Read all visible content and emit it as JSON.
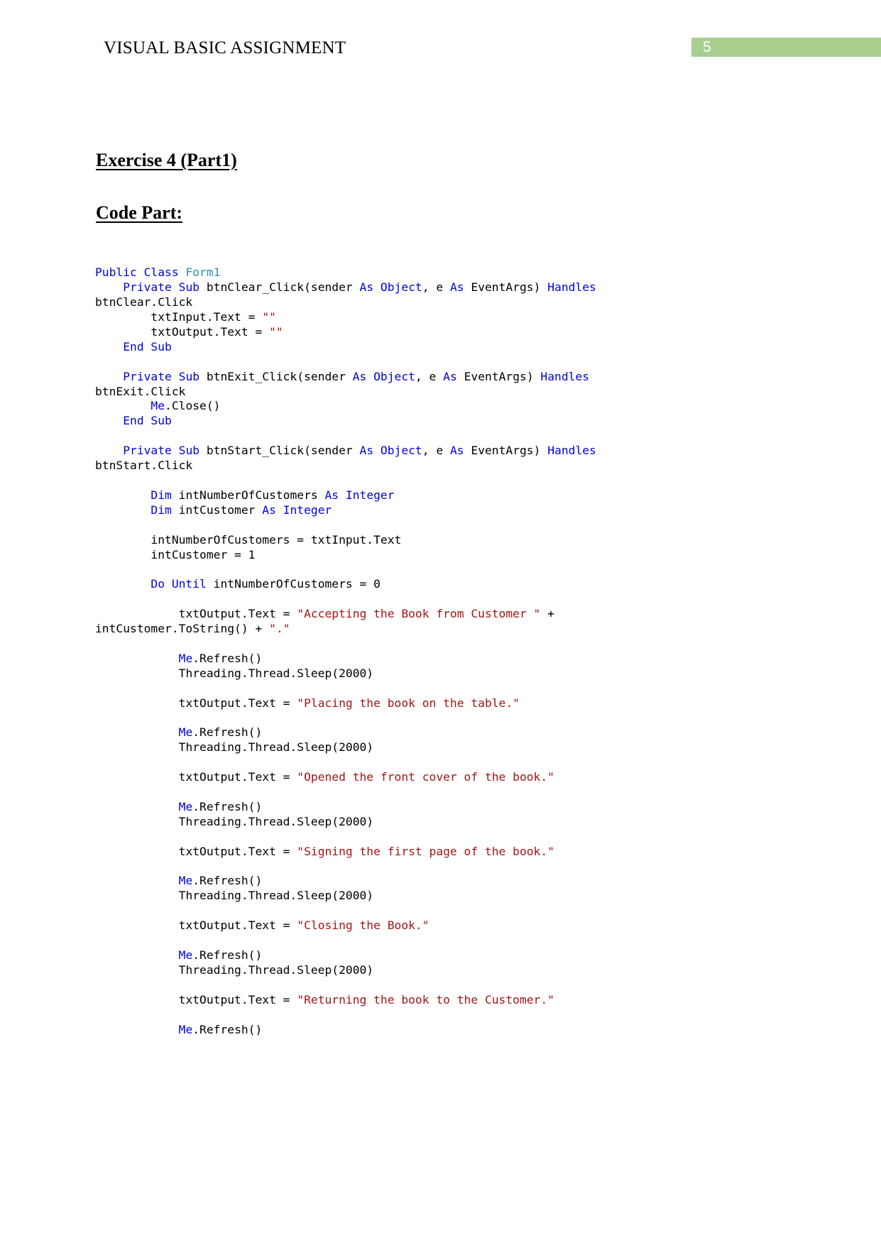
{
  "header": {
    "title": "VISUAL BASIC ASSIGNMENT",
    "page_number": "5",
    "bar_color": "#a9cf8e"
  },
  "headings": {
    "exercise": "Exercise 4 (Part1)",
    "code_part": "Code Part:"
  },
  "code": {
    "language": "Visual Basic .NET",
    "colors": {
      "keyword": "#0000e0",
      "type": "#2b91af",
      "string": "#a31515",
      "plain": "#000000"
    },
    "lines": [
      [
        {
          "t": "Public Class ",
          "c": "kw"
        },
        {
          "t": "Form1",
          "c": "typ"
        }
      ],
      [
        {
          "t": "    ",
          "c": "pl"
        },
        {
          "t": "Private Sub ",
          "c": "kw"
        },
        {
          "t": "btnClear_Click(sender ",
          "c": "pl"
        },
        {
          "t": "As Object",
          "c": "kw"
        },
        {
          "t": ", e ",
          "c": "pl"
        },
        {
          "t": "As ",
          "c": "kw"
        },
        {
          "t": "EventArgs) ",
          "c": "pl"
        },
        {
          "t": "Handles ",
          "c": "kw"
        },
        {
          "t": "btnClear.Click",
          "c": "pl"
        }
      ],
      [
        {
          "t": "        txtInput.Text = ",
          "c": "pl"
        },
        {
          "t": "\"\"",
          "c": "str"
        }
      ],
      [
        {
          "t": "        txtOutput.Text = ",
          "c": "pl"
        },
        {
          "t": "\"\"",
          "c": "str"
        }
      ],
      [
        {
          "t": "    ",
          "c": "pl"
        },
        {
          "t": "End Sub",
          "c": "kw"
        }
      ],
      [
        {
          "t": "",
          "c": "pl"
        }
      ],
      [
        {
          "t": "    ",
          "c": "pl"
        },
        {
          "t": "Private Sub ",
          "c": "kw"
        },
        {
          "t": "btnExit_Click(sender ",
          "c": "pl"
        },
        {
          "t": "As Object",
          "c": "kw"
        },
        {
          "t": ", e ",
          "c": "pl"
        },
        {
          "t": "As ",
          "c": "kw"
        },
        {
          "t": "EventArgs) ",
          "c": "pl"
        },
        {
          "t": "Handles ",
          "c": "kw"
        },
        {
          "t": "btnExit.Click",
          "c": "pl"
        }
      ],
      [
        {
          "t": "        ",
          "c": "pl"
        },
        {
          "t": "Me",
          "c": "kw"
        },
        {
          "t": ".Close()",
          "c": "pl"
        }
      ],
      [
        {
          "t": "    ",
          "c": "pl"
        },
        {
          "t": "End Sub",
          "c": "kw"
        }
      ],
      [
        {
          "t": "",
          "c": "pl"
        }
      ],
      [
        {
          "t": "    ",
          "c": "pl"
        },
        {
          "t": "Private Sub ",
          "c": "kw"
        },
        {
          "t": "btnStart_Click(sender ",
          "c": "pl"
        },
        {
          "t": "As Object",
          "c": "kw"
        },
        {
          "t": ", e ",
          "c": "pl"
        },
        {
          "t": "As ",
          "c": "kw"
        },
        {
          "t": "EventArgs) ",
          "c": "pl"
        },
        {
          "t": "Handles ",
          "c": "kw"
        },
        {
          "t": "btnStart.Click",
          "c": "pl"
        }
      ],
      [
        {
          "t": "",
          "c": "pl"
        }
      ],
      [
        {
          "t": "        ",
          "c": "pl"
        },
        {
          "t": "Dim ",
          "c": "kw"
        },
        {
          "t": "intNumberOfCustomers ",
          "c": "pl"
        },
        {
          "t": "As Integer",
          "c": "kw"
        }
      ],
      [
        {
          "t": "        ",
          "c": "pl"
        },
        {
          "t": "Dim ",
          "c": "kw"
        },
        {
          "t": "intCustomer ",
          "c": "pl"
        },
        {
          "t": "As Integer",
          "c": "kw"
        }
      ],
      [
        {
          "t": "",
          "c": "pl"
        }
      ],
      [
        {
          "t": "        intNumberOfCustomers = txtInput.Text",
          "c": "pl"
        }
      ],
      [
        {
          "t": "        intCustomer = 1",
          "c": "pl"
        }
      ],
      [
        {
          "t": "",
          "c": "pl"
        }
      ],
      [
        {
          "t": "        ",
          "c": "pl"
        },
        {
          "t": "Do Until ",
          "c": "kw"
        },
        {
          "t": "intNumberOfCustomers = 0",
          "c": "pl"
        }
      ],
      [
        {
          "t": "",
          "c": "pl"
        }
      ],
      [
        {
          "t": "            txtOutput.Text = ",
          "c": "pl"
        },
        {
          "t": "\"Accepting the Book from Customer \"",
          "c": "str"
        },
        {
          "t": " + intCustomer.ToString() + ",
          "c": "pl"
        },
        {
          "t": "\".\"",
          "c": "str"
        }
      ],
      [
        {
          "t": "",
          "c": "pl"
        }
      ],
      [
        {
          "t": "            ",
          "c": "pl"
        },
        {
          "t": "Me",
          "c": "kw"
        },
        {
          "t": ".Refresh()",
          "c": "pl"
        }
      ],
      [
        {
          "t": "            Threading.Thread.Sleep(2000)",
          "c": "pl"
        }
      ],
      [
        {
          "t": "",
          "c": "pl"
        }
      ],
      [
        {
          "t": "            txtOutput.Text = ",
          "c": "pl"
        },
        {
          "t": "\"Placing the book on the table.\"",
          "c": "str"
        }
      ],
      [
        {
          "t": "",
          "c": "pl"
        }
      ],
      [
        {
          "t": "            ",
          "c": "pl"
        },
        {
          "t": "Me",
          "c": "kw"
        },
        {
          "t": ".Refresh()",
          "c": "pl"
        }
      ],
      [
        {
          "t": "            Threading.Thread.Sleep(2000)",
          "c": "pl"
        }
      ],
      [
        {
          "t": "",
          "c": "pl"
        }
      ],
      [
        {
          "t": "            txtOutput.Text = ",
          "c": "pl"
        },
        {
          "t": "\"Opened the front cover of the book.\"",
          "c": "str"
        }
      ],
      [
        {
          "t": "",
          "c": "pl"
        }
      ],
      [
        {
          "t": "            ",
          "c": "pl"
        },
        {
          "t": "Me",
          "c": "kw"
        },
        {
          "t": ".Refresh()",
          "c": "pl"
        }
      ],
      [
        {
          "t": "            Threading.Thread.Sleep(2000)",
          "c": "pl"
        }
      ],
      [
        {
          "t": "",
          "c": "pl"
        }
      ],
      [
        {
          "t": "            txtOutput.Text = ",
          "c": "pl"
        },
        {
          "t": "\"Signing the first page of the book.\"",
          "c": "str"
        }
      ],
      [
        {
          "t": "",
          "c": "pl"
        }
      ],
      [
        {
          "t": "            ",
          "c": "pl"
        },
        {
          "t": "Me",
          "c": "kw"
        },
        {
          "t": ".Refresh()",
          "c": "pl"
        }
      ],
      [
        {
          "t": "            Threading.Thread.Sleep(2000)",
          "c": "pl"
        }
      ],
      [
        {
          "t": "",
          "c": "pl"
        }
      ],
      [
        {
          "t": "            txtOutput.Text = ",
          "c": "pl"
        },
        {
          "t": "\"Closing the Book.\"",
          "c": "str"
        }
      ],
      [
        {
          "t": "",
          "c": "pl"
        }
      ],
      [
        {
          "t": "            ",
          "c": "pl"
        },
        {
          "t": "Me",
          "c": "kw"
        },
        {
          "t": ".Refresh()",
          "c": "pl"
        }
      ],
      [
        {
          "t": "            Threading.Thread.Sleep(2000)",
          "c": "pl"
        }
      ],
      [
        {
          "t": "",
          "c": "pl"
        }
      ],
      [
        {
          "t": "            txtOutput.Text = ",
          "c": "pl"
        },
        {
          "t": "\"Returning the book to the Customer.\"",
          "c": "str"
        }
      ],
      [
        {
          "t": "",
          "c": "pl"
        }
      ],
      [
        {
          "t": "            ",
          "c": "pl"
        },
        {
          "t": "Me",
          "c": "kw"
        },
        {
          "t": ".Refresh()",
          "c": "pl"
        }
      ]
    ]
  }
}
